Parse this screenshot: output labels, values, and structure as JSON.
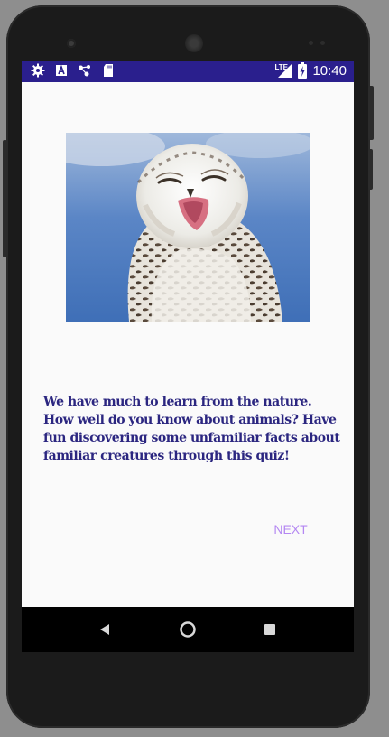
{
  "status_bar": {
    "time": "10:40",
    "network_label": "LTE",
    "left_icons": [
      "gear-icon",
      "a-icon",
      "share-icon",
      "sdcard-icon"
    ],
    "right_icons": [
      "lte-signal-icon",
      "battery-charging-icon"
    ],
    "background": "#2a1f8d"
  },
  "main": {
    "hero_image_subject": "smiling snowy owl",
    "intro_text": "We have much to learn from the nature. How well do you know about animals? Have fun discovering some unfamiliar facts about familiar creatures through this quiz!",
    "intro_color": "#2b2680",
    "next_label": "NEXT",
    "next_color": "#b487f2"
  },
  "nav_bar": {
    "items": [
      "back-icon",
      "home-icon",
      "recents-icon"
    ]
  }
}
